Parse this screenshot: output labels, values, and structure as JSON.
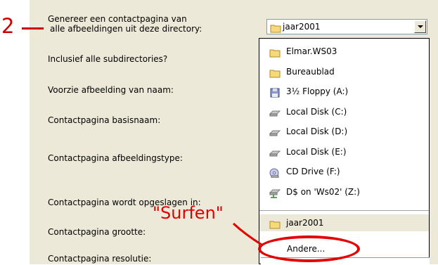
{
  "annotations": {
    "step_number": "2",
    "surfen_label": "\"Surfen\"",
    "highlight_color": "#e30000"
  },
  "labels": {
    "generate_line1": "Genereer een contactpagina van",
    "generate_line2": "alle afbeeldingen uit deze directory:",
    "include_subdirs": "Inclusief alle subdirectories?",
    "name_images": "Voorzie afbeelding van naam:",
    "base_name": "Contactpagina basisnaam:",
    "image_type": "Contactpagina afbeeldingstype:",
    "saved_in": "Contactpagina wordt opgeslagen in:",
    "size": "Contactpagina grootte:",
    "resolution": "Contactpagina resolutie:"
  },
  "directory_combo": {
    "selected": "jaar2001",
    "selected_icon": "folder-icon"
  },
  "dropdown": {
    "items": [
      {
        "label": "Elmar.WS03",
        "icon": "folder-icon"
      },
      {
        "label": "Bureaublad",
        "icon": "folder-icon"
      },
      {
        "label": "3½ Floppy (A:)",
        "icon": "floppy-icon"
      },
      {
        "label": "Local Disk (C:)",
        "icon": "hard-disk-icon"
      },
      {
        "label": "Local Disk (D:)",
        "icon": "hard-disk-icon"
      },
      {
        "label": "Local Disk (E:)",
        "icon": "hard-disk-icon"
      },
      {
        "label": "CD Drive (F:)",
        "icon": "cd-drive-icon"
      },
      {
        "label": "D$ on 'Ws02' (Z:)",
        "icon": "network-drive-icon"
      }
    ],
    "recent": {
      "label": "jaar2001",
      "icon": "folder-icon"
    },
    "other": "Andere..."
  },
  "colors": {
    "dialog_bg": "#ece9d8",
    "annotation_red": "#cc0000"
  }
}
